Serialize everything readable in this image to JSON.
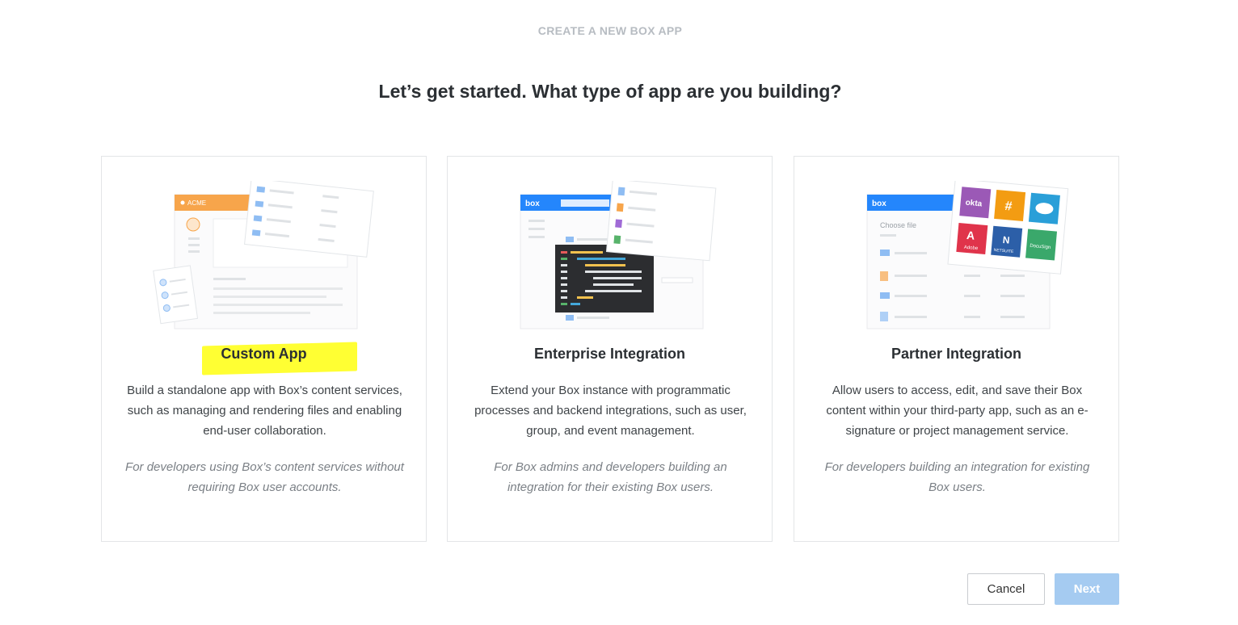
{
  "header": {
    "eyebrow": "CREATE A NEW BOX APP",
    "headline": "Let’s get started. What type of app are you building?"
  },
  "cards": [
    {
      "title": "Custom App",
      "description": "Build a standalone app with Box’s content services, such as managing and rendering files and enabling end-user collaboration.",
      "note": "For developers using Box’s content services without requiring Box user accounts.",
      "highlighted": true,
      "illustration_label": "ACME"
    },
    {
      "title": "Enterprise Integration",
      "description": "Extend your Box instance with programmatic processes and backend integrations, such as user, group, and event management.",
      "note": "For Box admins and developers building an integration for their existing Box users.",
      "illustration_label": "box"
    },
    {
      "title": "Partner Integration",
      "description": "Allow users to access, edit, and save their Box content within your third-party app, such as an e-signature or project management service.",
      "note": "For developers building an integration for existing Box users.",
      "illustration_label": "box",
      "illustration_sublabel": "Choose file",
      "partner_logos": [
        "okta",
        "Adobe",
        "NETSUITE",
        "DocuSign"
      ]
    }
  ],
  "footer": {
    "cancel_label": "Cancel",
    "next_label": "Next"
  },
  "colors": {
    "highlight": "#ffff33",
    "next_button": "#a5cbf1",
    "box_blue": "#2486fc",
    "acme_orange": "#f7a54b"
  }
}
